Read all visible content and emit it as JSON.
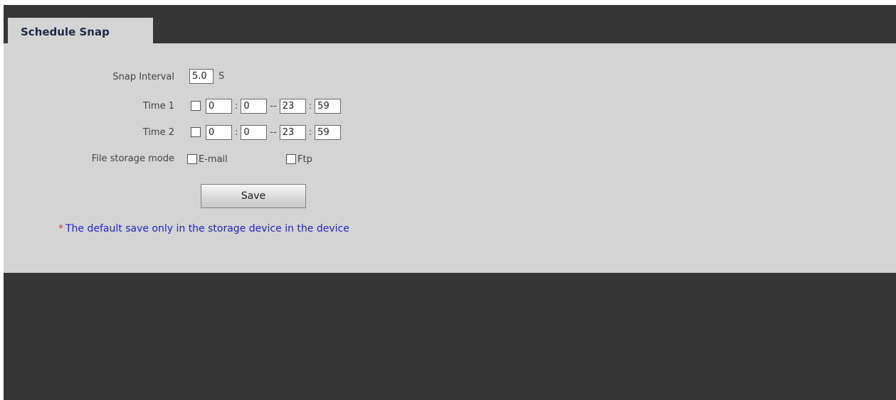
{
  "tab": {
    "title": "Schedule Snap"
  },
  "snap_interval": {
    "label": "Snap Interval",
    "value": "5.0",
    "unit": "S"
  },
  "time1": {
    "label": "Time 1",
    "start_hour": "0",
    "start_min": "0",
    "end_hour": "23",
    "end_min": "59",
    "checked": false
  },
  "time2": {
    "label": "Time 2",
    "start_hour": "0",
    "start_min": "0",
    "end_hour": "23",
    "end_min": "59",
    "checked": false
  },
  "separators": {
    "colon": ":",
    "dash": "--"
  },
  "storage": {
    "label": "File storage mode",
    "email_label": "E-mail",
    "ftp_label": "Ftp"
  },
  "save_label": "Save",
  "note": {
    "star": "*",
    "text": "The default save only in the storage device in the device"
  }
}
